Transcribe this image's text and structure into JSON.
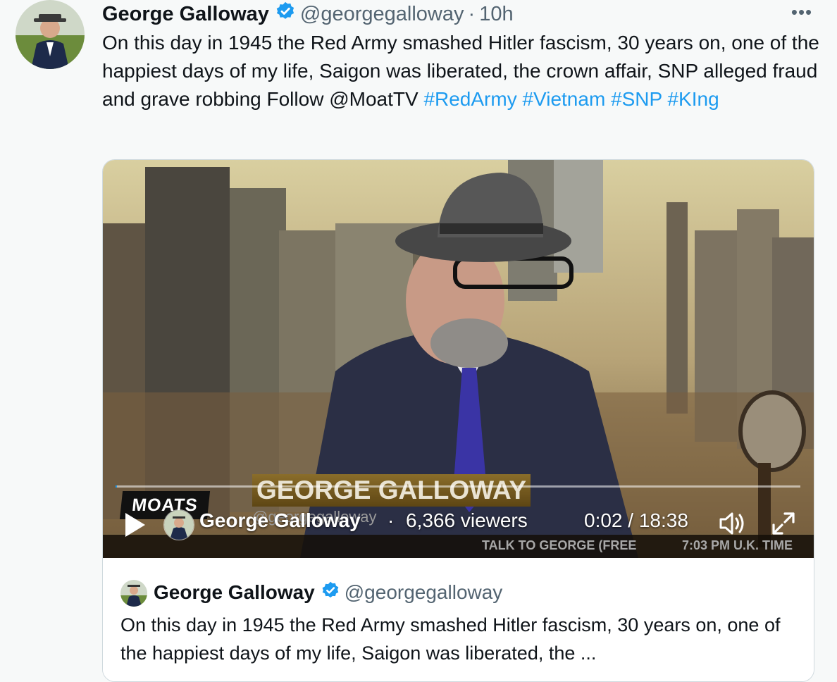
{
  "tweet": {
    "author_name": "George Galloway",
    "handle": "@georgegalloway",
    "separator": "·",
    "time": "10h",
    "more_label": "•••",
    "text_plain": "On this day in 1945 the Red Army smashed Hitler fascism, 30 years on, one of the happiest days of my life, Saigon was liberated, the crown affair, SNP alleged fraud and grave robbing  Follow @MoatTV",
    "hashtags": [
      "#RedArmy",
      "#Vietnam",
      "#SNP",
      "#KIng"
    ]
  },
  "video": {
    "lower_third_name": "GEORGE GALLOWAY",
    "lower_third_handle": "@georgegalloway",
    "logo_text": "MOATS",
    "ticker_left": "TALK TO GEORGE (FREE",
    "ticker_right": "7:03 PM U.K. TIME",
    "host_name": "George Galloway",
    "dot": "·",
    "viewers": "6,366 viewers",
    "elapsed": "0:02",
    "duration": "18:38",
    "time_display": "0:02 / 18:38",
    "progress_fraction": 0.002,
    "play_icon": "play-icon",
    "volume_icon": "volume-icon",
    "fullscreen_icon": "fullscreen-icon"
  },
  "quote": {
    "author_name": "George Galloway",
    "handle": "@georgegalloway",
    "text": "On this day in 1945 the Red Army smashed Hitler fascism, 30 years on, one of the happiest days of my life, Saigon was liberated, the ..."
  },
  "colors": {
    "link": "#1d9bf0",
    "text": "#0f1419",
    "secondary": "#536471",
    "background": "#f7f9f9",
    "border": "#cfd9de"
  }
}
